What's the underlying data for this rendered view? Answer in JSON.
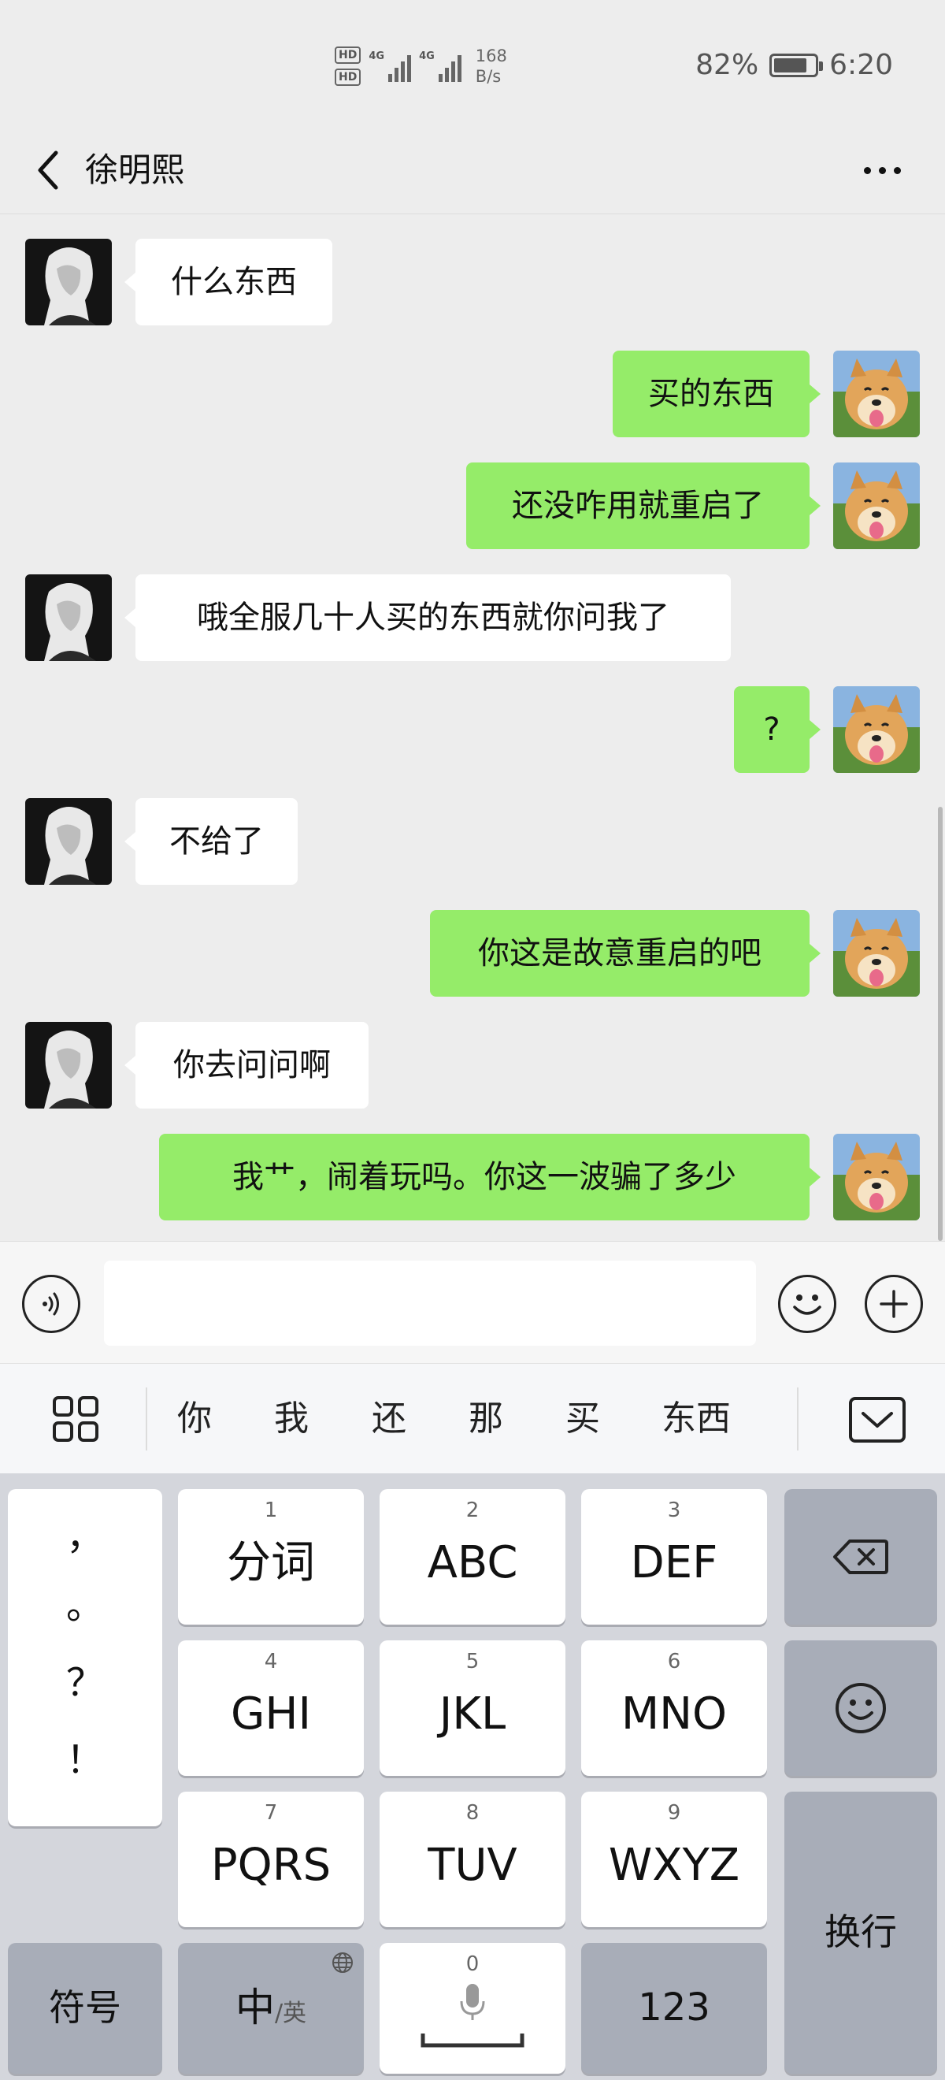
{
  "status_bar": {
    "hd1": "HD",
    "hd2": "HD",
    "net1": "4G",
    "net2": "4G",
    "speed_value": "168",
    "speed_unit": "B/s",
    "battery": "82%",
    "battery_level": 0.82,
    "time": "6:20"
  },
  "header": {
    "title": "徐明熙",
    "back_icon": "chevron-left-icon",
    "more_icon": "more-dots-icon"
  },
  "messages": [
    {
      "side": "left",
      "text": "什么东西"
    },
    {
      "side": "right",
      "text": "买的东西"
    },
    {
      "side": "right",
      "text": "还没咋用就重启了"
    },
    {
      "side": "left",
      "text": "哦全服几十人买的东西就你问我了"
    },
    {
      "side": "right",
      "text": "?"
    },
    {
      "side": "left",
      "text": "不给了"
    },
    {
      "side": "right",
      "text": "你这是故意重启的吧"
    },
    {
      "side": "left",
      "text": "你去问问啊"
    },
    {
      "side": "right",
      "text": "我艹，闹着玩吗。你这一波骗了多少"
    }
  ],
  "input_bar": {
    "value": "",
    "voice_icon": "voice-icon",
    "emoji_icon": "emoji-icon",
    "plus_icon": "plus-icon"
  },
  "candidates": [
    "你",
    "我",
    "还",
    "那",
    "买",
    "东西"
  ],
  "keyboard": {
    "punct_keys": [
      "，",
      "。",
      "？",
      "！"
    ],
    "keys": [
      {
        "num": "1",
        "label": "分词"
      },
      {
        "num": "2",
        "label": "ABC"
      },
      {
        "num": "3",
        "label": "DEF"
      },
      {
        "num": "4",
        "label": "GHI"
      },
      {
        "num": "5",
        "label": "JKL"
      },
      {
        "num": "6",
        "label": "MNO"
      },
      {
        "num": "7",
        "label": "PQRS"
      },
      {
        "num": "8",
        "label": "TUV"
      },
      {
        "num": "9",
        "label": "WXYZ"
      }
    ],
    "symbols": "符号",
    "lang_main": "中",
    "lang_sub": "/英",
    "space_num": "0",
    "numbers": "123",
    "enter": "换行"
  },
  "colors": {
    "self_bubble": "#95ec69",
    "other_bubble": "#ffffff",
    "chat_bg": "#ededed",
    "keyboard_bg": "#d4d6dc"
  }
}
